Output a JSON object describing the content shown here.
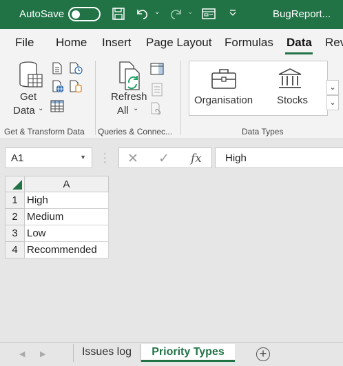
{
  "titlebar": {
    "autosave_label": "AutoSave",
    "filename": "BugReport...",
    "colors": {
      "bg": "#217346",
      "text": "#ffffff"
    },
    "icons": [
      "save-icon",
      "undo-icon",
      "redo-icon",
      "form-icon",
      "customize-qat-icon"
    ]
  },
  "tabs": [
    {
      "label": "File"
    },
    {
      "label": "Home"
    },
    {
      "label": "Insert"
    },
    {
      "label": "Page Layout"
    },
    {
      "label": "Formulas"
    },
    {
      "label": "Data",
      "active": true
    },
    {
      "label": "Rev"
    }
  ],
  "ribbon": {
    "get_data_line1": "Get",
    "get_data_line2": "Data",
    "refresh_line1": "Refresh",
    "refresh_line2": "All",
    "organisation": "Organisation",
    "stocks": "Stocks",
    "groups": {
      "get_transform": "Get & Transform Data",
      "queries": "Queries & Connec...",
      "data_types": "Data Types"
    }
  },
  "formula_bar": {
    "name_box": "A1",
    "fx_label": "fx",
    "value": "High"
  },
  "grid": {
    "column_header": "A",
    "rows": [
      {
        "num": "1",
        "value": "High"
      },
      {
        "num": "2",
        "value": "Medium"
      },
      {
        "num": "3",
        "value": "Low"
      },
      {
        "num": "4",
        "value": "Recommended"
      }
    ]
  },
  "sheets": {
    "tabs": [
      {
        "label": "Issues log",
        "active": false
      },
      {
        "label": "Priority Types",
        "active": true
      }
    ],
    "add_label": "+"
  },
  "accent_color": "#217346"
}
